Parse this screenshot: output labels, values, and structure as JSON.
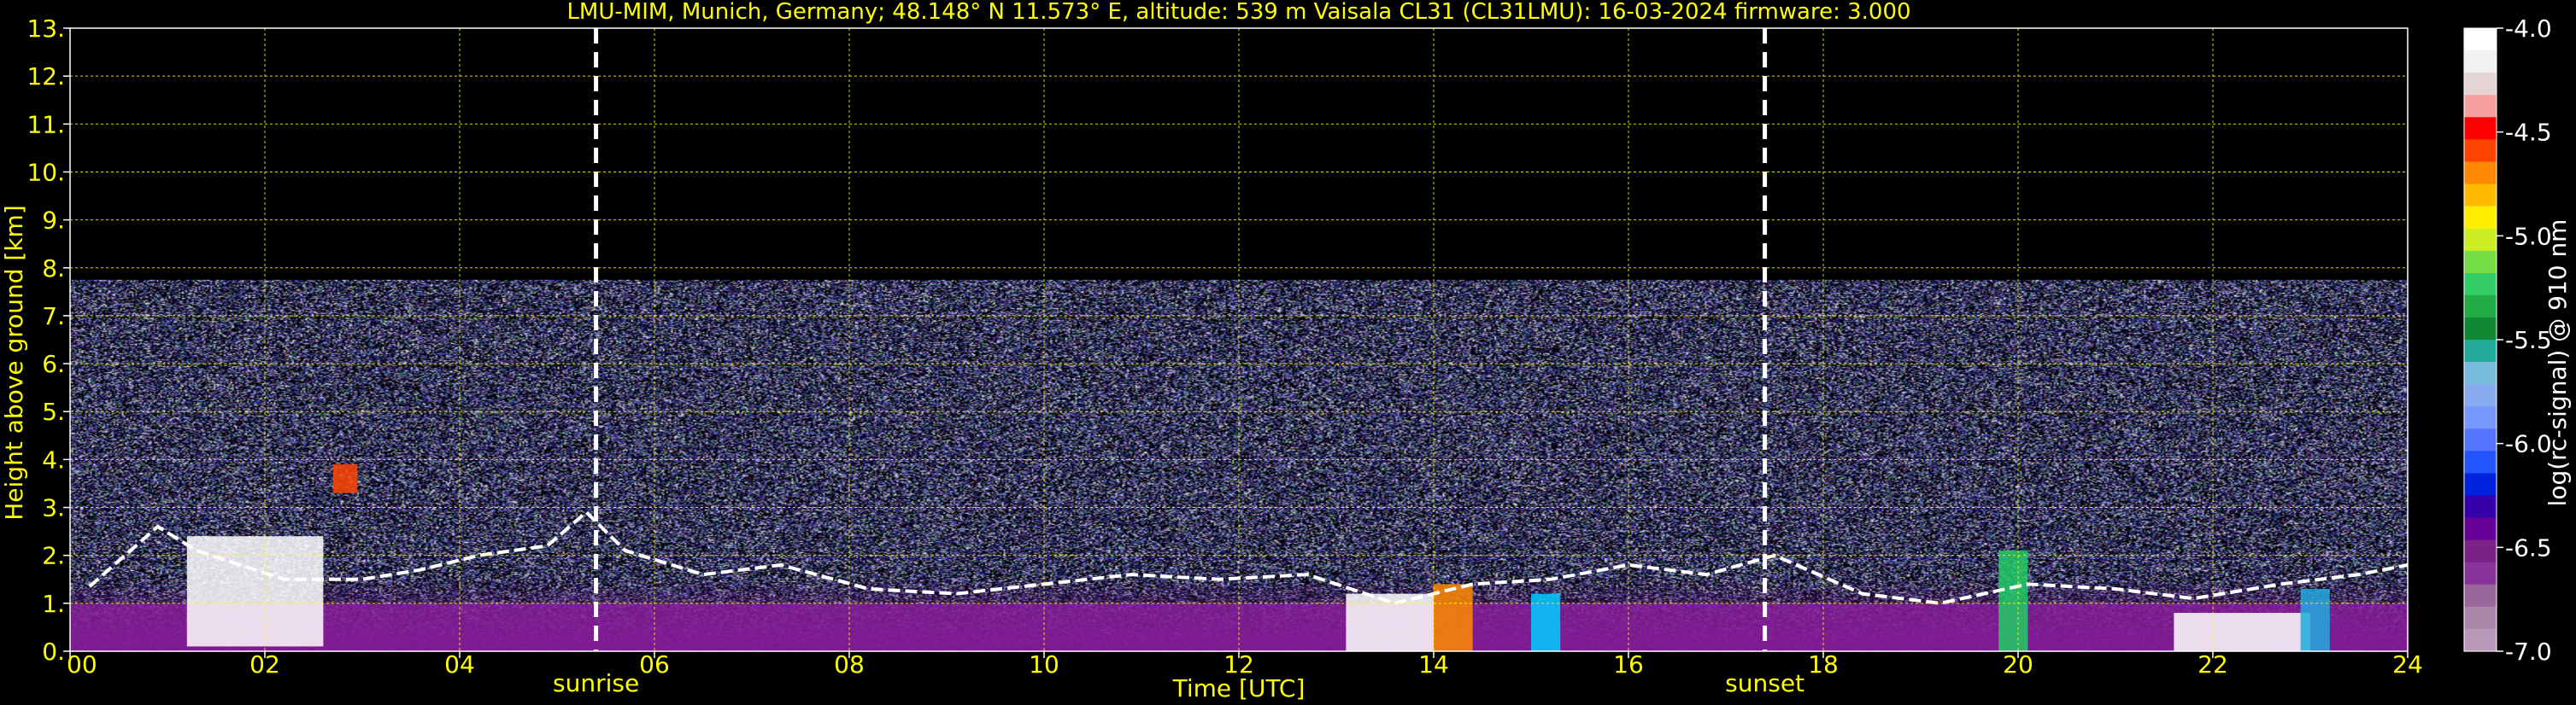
{
  "chart_data": {
    "type": "heatmap",
    "title": "LMU-MIM, Munich, Germany; 48.148° N 11.573° E, altitude: 539 m    Vaisala CL31 (CL31LMU): 16-03-2024    firmware: 3.000",
    "xlabel": "Time [UTC]",
    "ylabel": "Height above ground [km]",
    "xlim": [
      0,
      24
    ],
    "ylim": [
      0,
      13
    ],
    "x_ticks": [
      "00",
      "02",
      "04",
      "06",
      "08",
      "10",
      "12",
      "14",
      "16",
      "18",
      "20",
      "22",
      "24"
    ],
    "x_tick_values": [
      0,
      2,
      4,
      6,
      8,
      10,
      12,
      14,
      16,
      18,
      20,
      22,
      24
    ],
    "y_ticks": [
      "0.",
      "1.",
      "2.",
      "3.",
      "4.",
      "5.",
      "6.",
      "7.",
      "8.",
      "9.",
      "10.",
      "11.",
      "12.",
      "13."
    ],
    "y_tick_values": [
      0,
      1,
      2,
      3,
      4,
      5,
      6,
      7,
      8,
      9,
      10,
      11,
      12,
      13
    ],
    "grid": true,
    "grid_color": "#ffff00",
    "noise_top_km": 7.75,
    "events": [
      {
        "label": "sunrise",
        "x": 5.4
      },
      {
        "label": "sunset",
        "x": 17.4
      }
    ],
    "colorbar": {
      "label": "log(rc-signal) @ 910 nm",
      "range": [
        -7.0,
        -4.0
      ],
      "ticks": [
        "-4.0",
        "-4.5",
        "-5.0",
        "-5.5",
        "-6.0",
        "-6.5",
        "-7.0"
      ],
      "tick_values": [
        -4.0,
        -4.5,
        -5.0,
        -5.5,
        -6.0,
        -6.5,
        -7.0
      ],
      "colors_top_to_bottom": [
        "#ffffff",
        "#f2f2f2",
        "#e6d4d4",
        "#f5a0a0",
        "#ff0000",
        "#ff4400",
        "#ff8800",
        "#ffbb00",
        "#ffee00",
        "#ccee22",
        "#77dd44",
        "#33cc66",
        "#22aa44",
        "#118833",
        "#22aa99",
        "#77bbdd",
        "#88aaee",
        "#7799ff",
        "#5577ff",
        "#2255ff",
        "#0022dd",
        "#3300aa",
        "#660099",
        "#7a2288",
        "#883399",
        "#996699",
        "#aa88aa",
        "#b899b8"
      ]
    },
    "layers": {
      "background_km": {
        "from": 0,
        "to": 1.0,
        "color": "#8c1f9e"
      },
      "cloud_base": [
        {
          "x": 0.2,
          "y": 1.35
        },
        {
          "x": 0.9,
          "y": 2.6
        },
        {
          "x": 1.3,
          "y": 2.1
        },
        {
          "x": 2.2,
          "y": 1.5
        },
        {
          "x": 3.0,
          "y": 1.5
        },
        {
          "x": 3.6,
          "y": 1.7
        },
        {
          "x": 4.2,
          "y": 2.0
        },
        {
          "x": 4.9,
          "y": 2.2
        },
        {
          "x": 5.3,
          "y": 2.9
        },
        {
          "x": 5.7,
          "y": 2.1
        },
        {
          "x": 6.5,
          "y": 1.6
        },
        {
          "x": 7.3,
          "y": 1.8
        },
        {
          "x": 8.2,
          "y": 1.3
        },
        {
          "x": 9.1,
          "y": 1.2
        },
        {
          "x": 10.0,
          "y": 1.4
        },
        {
          "x": 10.9,
          "y": 1.6
        },
        {
          "x": 11.8,
          "y": 1.5
        },
        {
          "x": 12.7,
          "y": 1.6
        },
        {
          "x": 13.6,
          "y": 1.0
        },
        {
          "x": 14.4,
          "y": 1.4
        },
        {
          "x": 15.2,
          "y": 1.5
        },
        {
          "x": 16.0,
          "y": 1.8
        },
        {
          "x": 16.8,
          "y": 1.6
        },
        {
          "x": 17.5,
          "y": 2.0
        },
        {
          "x": 18.4,
          "y": 1.2
        },
        {
          "x": 19.2,
          "y": 1.0
        },
        {
          "x": 20.1,
          "y": 1.4
        },
        {
          "x": 21.0,
          "y": 1.3
        },
        {
          "x": 21.8,
          "y": 1.1
        },
        {
          "x": 22.7,
          "y": 1.4
        },
        {
          "x": 23.5,
          "y": 1.6
        },
        {
          "x": 24.0,
          "y": 1.8
        }
      ],
      "hotspots": [
        {
          "x0": 1.2,
          "x1": 2.6,
          "y0": 0.1,
          "y1": 2.4,
          "color": "#ffffff"
        },
        {
          "x0": 2.7,
          "x1": 2.95,
          "y0": 3.3,
          "y1": 3.9,
          "color": "#ff4400"
        },
        {
          "x0": 13.1,
          "x1": 14.0,
          "y0": 0.0,
          "y1": 1.2,
          "color": "#ffffff"
        },
        {
          "x0": 14.0,
          "x1": 14.4,
          "y0": 0.0,
          "y1": 1.4,
          "color": "#ff8800"
        },
        {
          "x0": 15.0,
          "x1": 15.3,
          "y0": 0.0,
          "y1": 1.2,
          "color": "#00ccff"
        },
        {
          "x0": 19.8,
          "x1": 20.1,
          "y0": 0.0,
          "y1": 2.1,
          "color": "#22cc66"
        },
        {
          "x0": 21.6,
          "x1": 23.0,
          "y0": 0.0,
          "y1": 0.8,
          "color": "#ffffff"
        },
        {
          "x0": 22.9,
          "x1": 23.2,
          "y0": 0.0,
          "y1": 1.3,
          "color": "#22aadd"
        }
      ]
    }
  }
}
